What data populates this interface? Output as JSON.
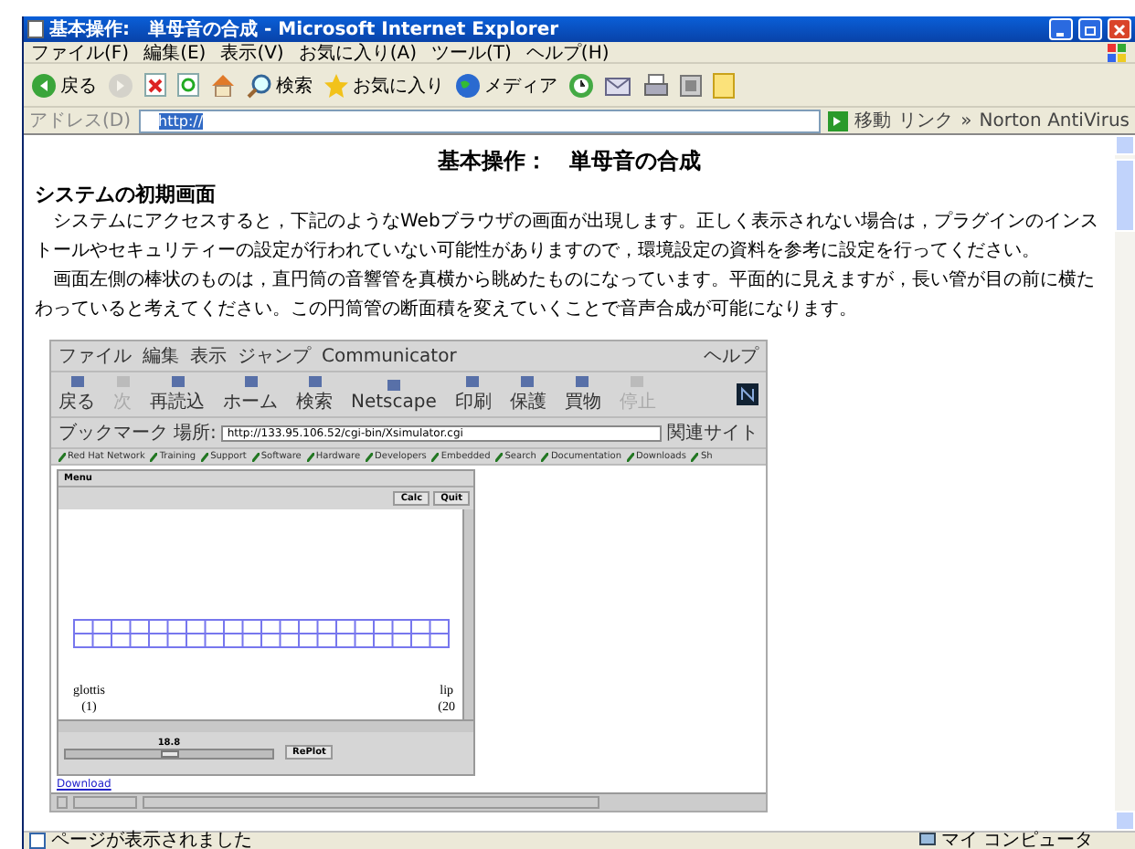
{
  "window": {
    "title": "基本操作:　単母音の合成 - Microsoft Internet Explorer"
  },
  "menu": [
    "ファイル(F)",
    "編集(E)",
    "表示(V)",
    "お気に入り(A)",
    "ツール(T)",
    "ヘルプ(H)"
  ],
  "toolbar": [
    {
      "kind": "back",
      "label": "戻る",
      "disabled": false
    },
    {
      "kind": "forward",
      "disabled": true
    },
    {
      "kind": "stop",
      "disabled": false
    },
    {
      "kind": "refresh",
      "disabled": false
    },
    {
      "kind": "home",
      "disabled": false
    },
    {
      "kind": "search",
      "label": "検索",
      "disabled": false
    },
    {
      "kind": "favorites",
      "label": "お気に入り",
      "disabled": false
    },
    {
      "kind": "media",
      "label": "メディア",
      "disabled": false
    },
    {
      "kind": "history",
      "disabled": false
    },
    {
      "kind": "mail",
      "disabled": false
    },
    {
      "kind": "print",
      "disabled": false
    },
    {
      "kind": "edit",
      "disabled": false
    },
    {
      "kind": "note",
      "disabled": false
    }
  ],
  "address": {
    "label": "アドレス(D)",
    "value": "http://",
    "go": "移動",
    "links": "リンク",
    "links_more": "»",
    "addon": "Norton AntiVirus"
  },
  "page": {
    "title": "基本操作：　単母音の合成",
    "heading": "システムの初期画面",
    "paragraphs": [
      "システムにアクセスすると，下記のようなWebブラウザの画面が出現します。正しく表示されない場合は，プラグインのインストールやセキュリティーの設定が行われていない可能性がありますので，環境設定の資料を参考に設定を行ってください。",
      "画面左側の棒状のものは，直円筒の音響管を真横から眺めたものになっています。平面的に見えますが，長い管が目の前に横たわっていると考えてください。この円筒管の断面積を変えていくことで音声合成が可能になります。"
    ]
  },
  "inner": {
    "menu": [
      "ファイル",
      "編集",
      "表示",
      "ジャンプ",
      "Communicator"
    ],
    "help": "ヘルプ",
    "toolbar": [
      {
        "label": "戻る",
        "disabled": false
      },
      {
        "label": "次",
        "disabled": true
      },
      {
        "label": "再読込",
        "disabled": false
      },
      {
        "label": "ホーム",
        "disabled": false
      },
      {
        "label": "検索",
        "disabled": false
      },
      {
        "label": "Netscape",
        "disabled": false
      },
      {
        "label": "印刷",
        "disabled": false
      },
      {
        "label": "保護",
        "disabled": false
      },
      {
        "label": "買物",
        "disabled": false
      },
      {
        "label": "停止",
        "disabled": true
      }
    ],
    "bookmark": "ブックマーク",
    "location_label": "場所:",
    "url": "http://133.95.106.52/cgi-bin/Xsimulator.cgi",
    "related": "関連サイト",
    "personal": [
      "Red Hat Network",
      "Training",
      "Support",
      "Software",
      "Hardware",
      "Developers",
      "Embedded",
      "Search",
      "Documentation",
      "Downloads",
      "Sh"
    ],
    "app": {
      "menu": "Menu",
      "buttons": [
        "Calc",
        "Quit"
      ],
      "left_label": "glottis",
      "left_index": "(1)",
      "right_label": "lip",
      "right_index": "(20",
      "slider_value": "18.8",
      "level": 0.5,
      "replot": "RePlot"
    },
    "link": "Download"
  },
  "status": {
    "text": "ページが表示されました",
    "zone": "マイ コンピュータ"
  }
}
